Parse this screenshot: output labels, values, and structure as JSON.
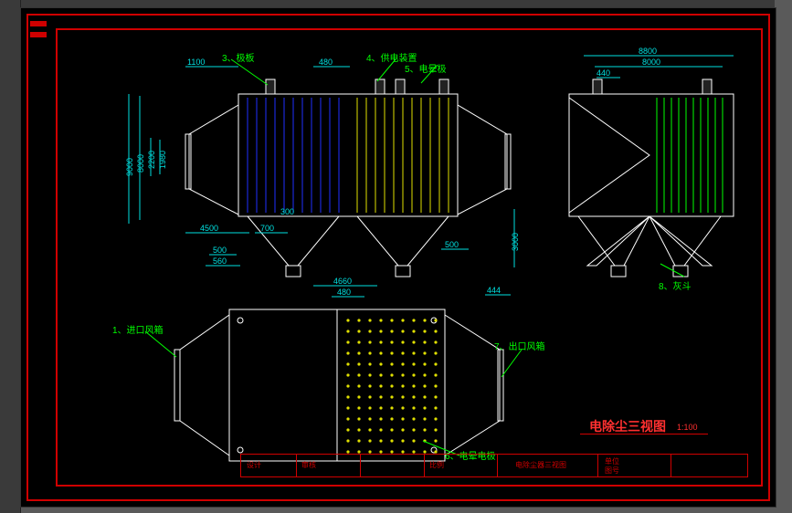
{
  "domain": "Diagram",
  "title": {
    "main": "电除尘三视图",
    "scale": "1:100",
    "block_title": "电除尘器三视图"
  },
  "callouts": {
    "c1": "1、进口风箱",
    "c3": "3、极板",
    "c4": "4、供电装置",
    "c5": "5、电晕极",
    "c6": "6、电晕电极",
    "c7": "7、出口风箱",
    "c8": "8、灰斗"
  },
  "dimensions": {
    "top": {
      "d1100": "1100",
      "d480a": "480",
      "d8800": "8800",
      "d8000a": "8000",
      "d440": "440"
    },
    "vleft": {
      "d9000": "9000",
      "d8000": "8000",
      "d2200": "2200",
      "d1980": "1980"
    },
    "mid": {
      "d4500": "4500",
      "d700": "700",
      "d300": "300",
      "d500a": "500",
      "d560": "560",
      "d500b": "500"
    },
    "bot": {
      "d4660": "4660",
      "d480b": "480",
      "d444": "444",
      "d3000": "3000"
    }
  },
  "titleblock": {
    "f1": "设计",
    "f2": "审核",
    "f3": "比例",
    "f4": "单位",
    "f5": "图号"
  }
}
